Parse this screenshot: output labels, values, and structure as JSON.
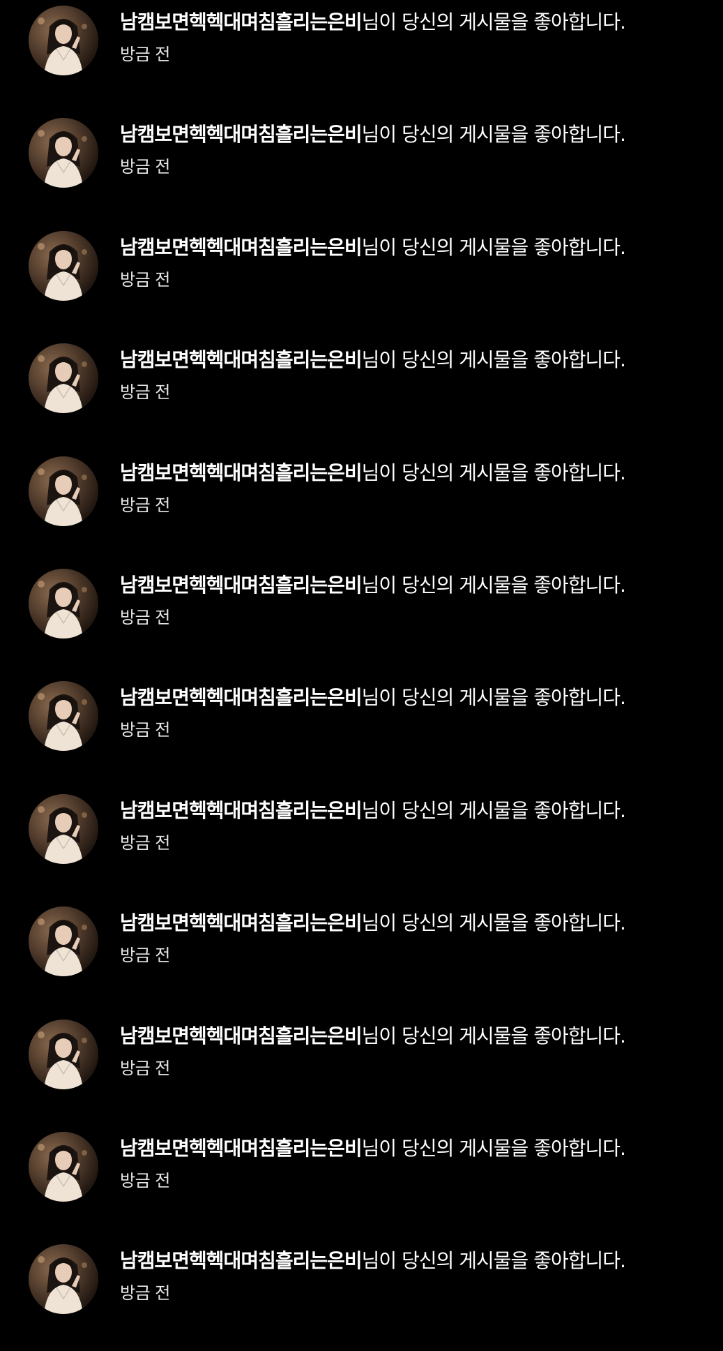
{
  "notifications": [
    {
      "username": "남캠보면헥헥대며침흘리는은비",
      "message": "님이 당신의 게시물을 좋아합니다.",
      "time": "방금 전",
      "avatar_icon": "profile-photo"
    },
    {
      "username": "남캠보면헥헥대며침흘리는은비",
      "message": "님이 당신의 게시물을 좋아합니다.",
      "time": "방금 전",
      "avatar_icon": "profile-photo"
    },
    {
      "username": "남캠보면헥헥대며침흘리는은비",
      "message": "님이 당신의 게시물을 좋아합니다.",
      "time": "방금 전",
      "avatar_icon": "profile-photo"
    },
    {
      "username": "남캠보면헥헥대며침흘리는은비",
      "message": "님이 당신의 게시물을 좋아합니다.",
      "time": "방금 전",
      "avatar_icon": "profile-photo"
    },
    {
      "username": "남캠보면헥헥대며침흘리는은비",
      "message": "님이 당신의 게시물을 좋아합니다.",
      "time": "방금 전",
      "avatar_icon": "profile-photo"
    },
    {
      "username": "남캠보면헥헥대며침흘리는은비",
      "message": "님이 당신의 게시물을 좋아합니다.",
      "time": "방금 전",
      "avatar_icon": "profile-photo"
    },
    {
      "username": "남캠보면헥헥대며침흘리는은비",
      "message": "님이 당신의 게시물을 좋아합니다.",
      "time": "방금 전",
      "avatar_icon": "profile-photo"
    },
    {
      "username": "남캠보면헥헥대며침흘리는은비",
      "message": "님이 당신의 게시물을 좋아합니다.",
      "time": "방금 전",
      "avatar_icon": "profile-photo"
    },
    {
      "username": "남캠보면헥헥대며침흘리는은비",
      "message": "님이 당신의 게시물을 좋아합니다.",
      "time": "방금 전",
      "avatar_icon": "profile-photo"
    },
    {
      "username": "남캠보면헥헥대며침흘리는은비",
      "message": "님이 당신의 게시물을 좋아합니다.",
      "time": "방금 전",
      "avatar_icon": "profile-photo"
    },
    {
      "username": "남캠보면헥헥대며침흘리는은비",
      "message": "님이 당신의 게시물을 좋아합니다.",
      "time": "방금 전",
      "avatar_icon": "profile-photo"
    },
    {
      "username": "남캠보면헥헥대며침흘리는은비",
      "message": "님이 당신의 게시물을 좋아합니다.",
      "time": "방금 전",
      "avatar_icon": "profile-photo"
    }
  ],
  "colors": {
    "background": "#000000",
    "text": "#ffffff",
    "time_text": "#e6e6e6"
  }
}
